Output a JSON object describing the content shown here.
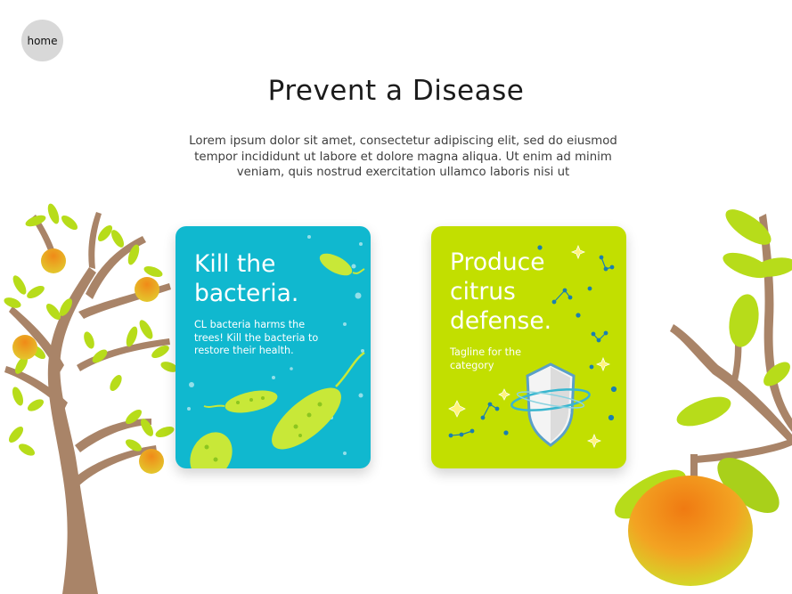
{
  "nav": {
    "home_label": "home"
  },
  "page": {
    "title": "Prevent a Disease",
    "intro": "Lorem ipsum dolor sit amet, consectetur adipiscing elit, sed do eiusmod tempor incididunt ut labore et dolore magna aliqua. Ut enim ad minim veniam, quis nostrud exercitation ullamco laboris nisi ut"
  },
  "cards": [
    {
      "title": "Kill the\nbacteria.",
      "text": "CL bacteria harms the trees! Kill the bacteria to restore their health.",
      "color": "#10b8cf",
      "illustration": "bacteria"
    },
    {
      "title": "Produce\ncitrus\ndefense.",
      "text": "Tagline for the category",
      "color": "#c2df00",
      "illustration": "shield-with-molecules"
    }
  ],
  "theme": {
    "leaf": "#b7dc1a",
    "trunk": "#a98468",
    "fruit": "#f29a1c"
  }
}
